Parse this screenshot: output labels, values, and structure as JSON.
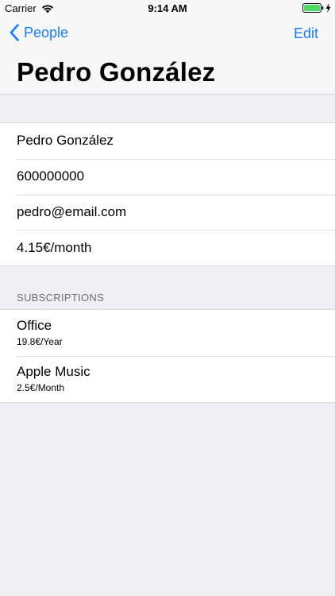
{
  "status_bar": {
    "carrier": "Carrier",
    "time": "9:14 AM",
    "icons": [
      "wifi-icon",
      "battery-icon",
      "charging-bolt-icon"
    ]
  },
  "nav": {
    "back_label": "People",
    "edit_label": "Edit",
    "title": "Pedro González",
    "accent_color": "#1a7cf5"
  },
  "info": {
    "name": "Pedro González",
    "phone": "600000000",
    "email": "pedro@email.com",
    "monthly_cost": "4.15€/month"
  },
  "subscriptions": {
    "header": "SUBSCRIPTIONS",
    "items": [
      {
        "title": "Office",
        "detail": "19.8€/Year"
      },
      {
        "title": "Apple Music",
        "detail": "2.5€/Month"
      }
    ]
  }
}
